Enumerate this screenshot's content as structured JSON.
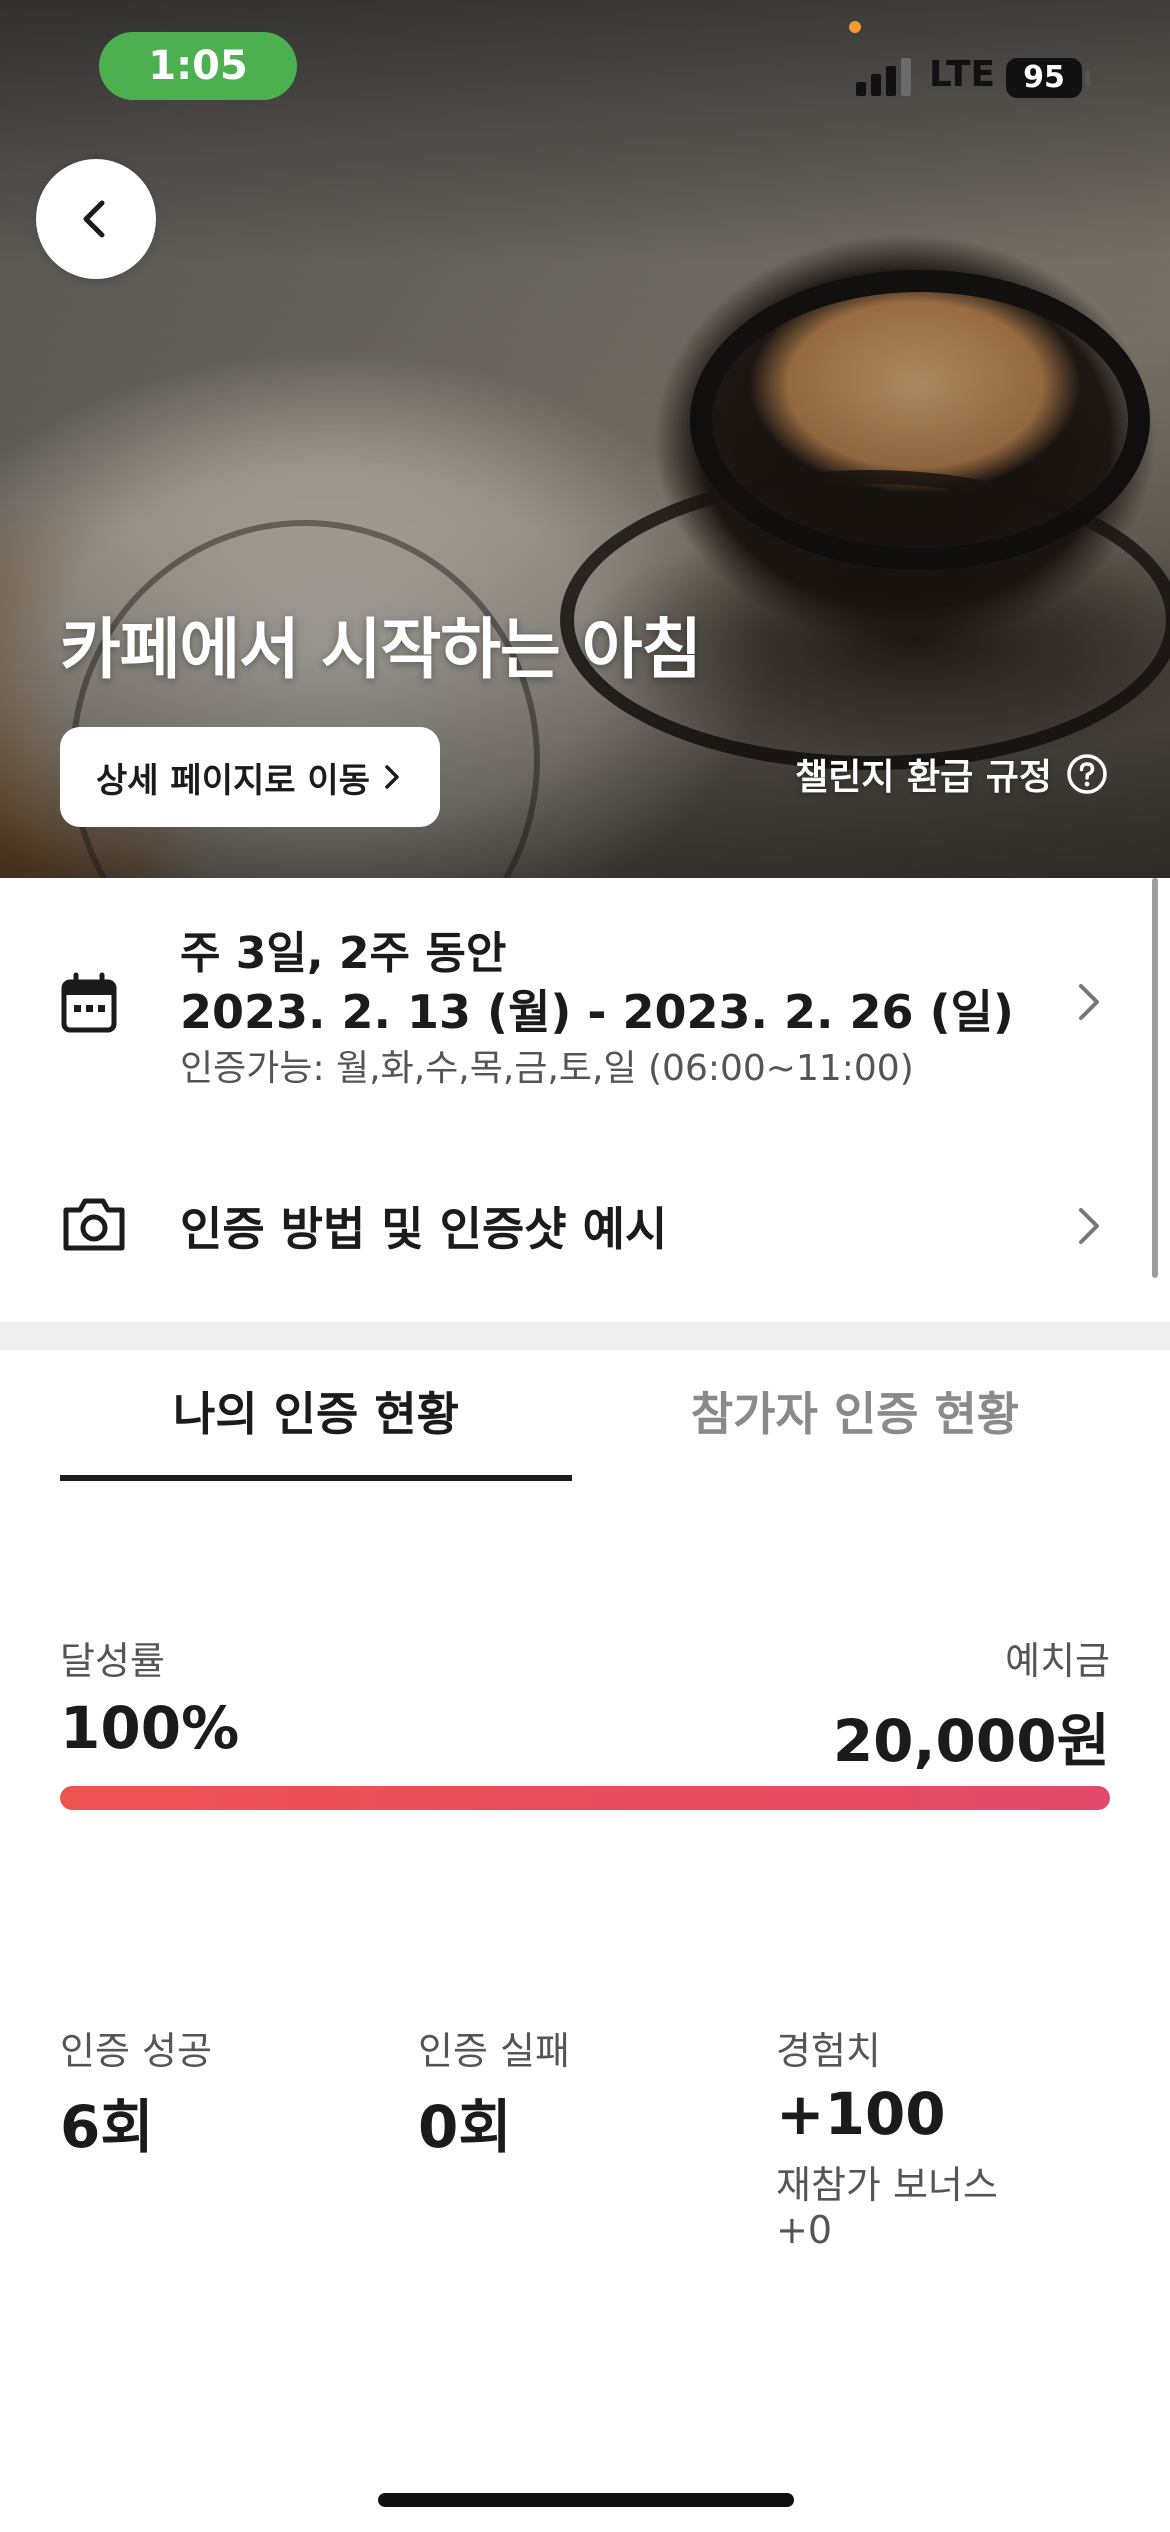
{
  "status_bar": {
    "time": "1:05",
    "network": "LTE",
    "battery": "95"
  },
  "hero": {
    "title": "카페에서 시작하는 아침",
    "detail_button": "상세 페이지로 이동",
    "refund_rules": "챌린지 환급 규정"
  },
  "schedule": {
    "frequency": "주 3일, 2주 동안",
    "date_range": "2023. 2. 13 (월) - 2023. 2. 26 (일)",
    "available": "인증가능: 월,화,수,목,금,토,일 (06:00~11:00)"
  },
  "verification_method": {
    "label": "인증 방법 및 인증샷 예시"
  },
  "tabs": [
    {
      "label": "나의 인증 현황",
      "active": true
    },
    {
      "label": "참가자 인증 현황",
      "active": false
    }
  ],
  "achievement": {
    "rate_label": "달성률",
    "rate_value": "100%",
    "rate_fraction": 1.0,
    "deposit_label": "예치금",
    "deposit_value": "20,000원"
  },
  "stats": {
    "success_label": "인증 성공",
    "success_value": "6회",
    "failure_label": "인증 실패",
    "failure_value": "0회",
    "exp_label": "경험치",
    "exp_value": "+100",
    "bonus_label": "재참가 보너스",
    "bonus_value": "+0"
  },
  "colors": {
    "accent_start": "#ef5350",
    "accent_end": "#e3486a",
    "time_pill": "#4caf50"
  },
  "icons": {
    "back": "chevron-left-icon",
    "calendar": "calendar-icon",
    "camera": "camera-icon",
    "help": "question-circle-icon"
  }
}
